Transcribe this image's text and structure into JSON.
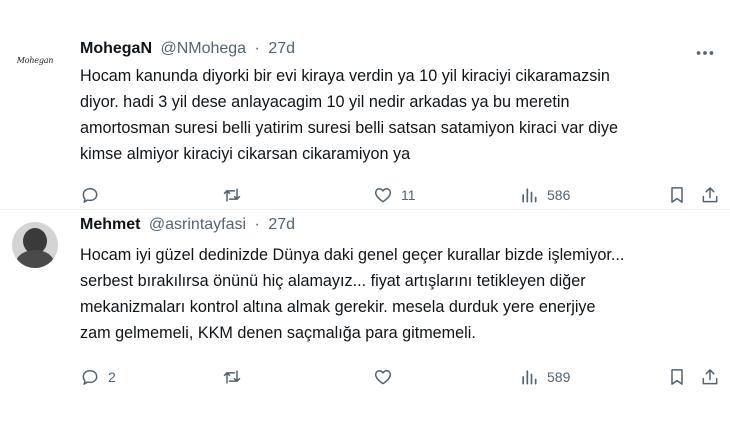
{
  "tweets": [
    {
      "avatar_text": "Mohegan",
      "display_name": "MohegaN",
      "handle": "@NMohega",
      "separator": "·",
      "time": "27d",
      "text": "Hocam kanunda diyorki bir evi kiraya verdin ya 10 yil kiraciyi cikaramazsin\ndiyor. hadi 3 yil dese anlayacagim 10 yil nedir arkadas ya bu meretin\namortosman suresi belli yatirim suresi belli satsan satamiyon kiraci var diye\nkimse almiyor kiraciyi cikarsan cikaramiyon ya",
      "replies": "",
      "retweets": "",
      "likes": "11",
      "views": "586"
    },
    {
      "display_name": "Mehmet",
      "handle": "@asrintayfasi",
      "separator": "·",
      "time": "27d",
      "text": "Hocam iyi güzel dedinizde Dünya daki genel geçer kurallar bizde işlemiyor...\nserbest bırakılırsa önünü hiç alamayız... fiyat artışlarını tetikleyen diğer\nmekanizmaları kontrol altına almak gerekir. mesela durduk yere enerjiye\nzam gelmemeli, KKM denen saçmalığa para gitmemeli.",
      "replies": "2",
      "retweets": "",
      "likes": "",
      "views": "589"
    }
  ],
  "icons": {
    "more": "more-horizontal-icon",
    "reply": "reply-bubble-icon",
    "retweet": "retweet-icon",
    "like": "heart-icon",
    "views": "bar-chart-icon",
    "bookmark": "bookmark-icon",
    "share": "share-upload-icon"
  },
  "colors": {
    "text": "#0f1419",
    "muted": "#536471",
    "divider": "#eff3f4"
  }
}
